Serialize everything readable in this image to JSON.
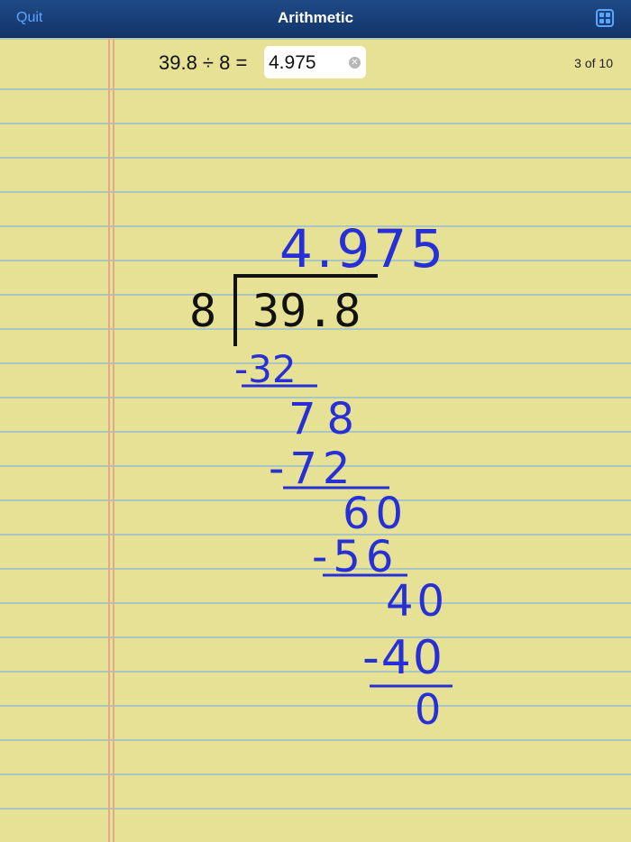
{
  "topbar": {
    "quit_label": "Quit",
    "title": "Arithmetic",
    "grid_icon": "grid-icon"
  },
  "problem": {
    "equation": "39.8 ÷ 8 =",
    "answer_value": "4.975",
    "clear_icon": "clear-icon",
    "counter": "3 of 10"
  },
  "work": {
    "divisor": "8",
    "dividend": "39.8",
    "quotient": "4.975",
    "steps": [
      "-32",
      "78",
      "-72",
      "60",
      "-56",
      "40",
      "-40",
      "0"
    ]
  },
  "colors": {
    "ink": "#2630d6",
    "paper": "#e6e194",
    "rule": "#a9c7c0",
    "margin": "#e5a88d"
  }
}
